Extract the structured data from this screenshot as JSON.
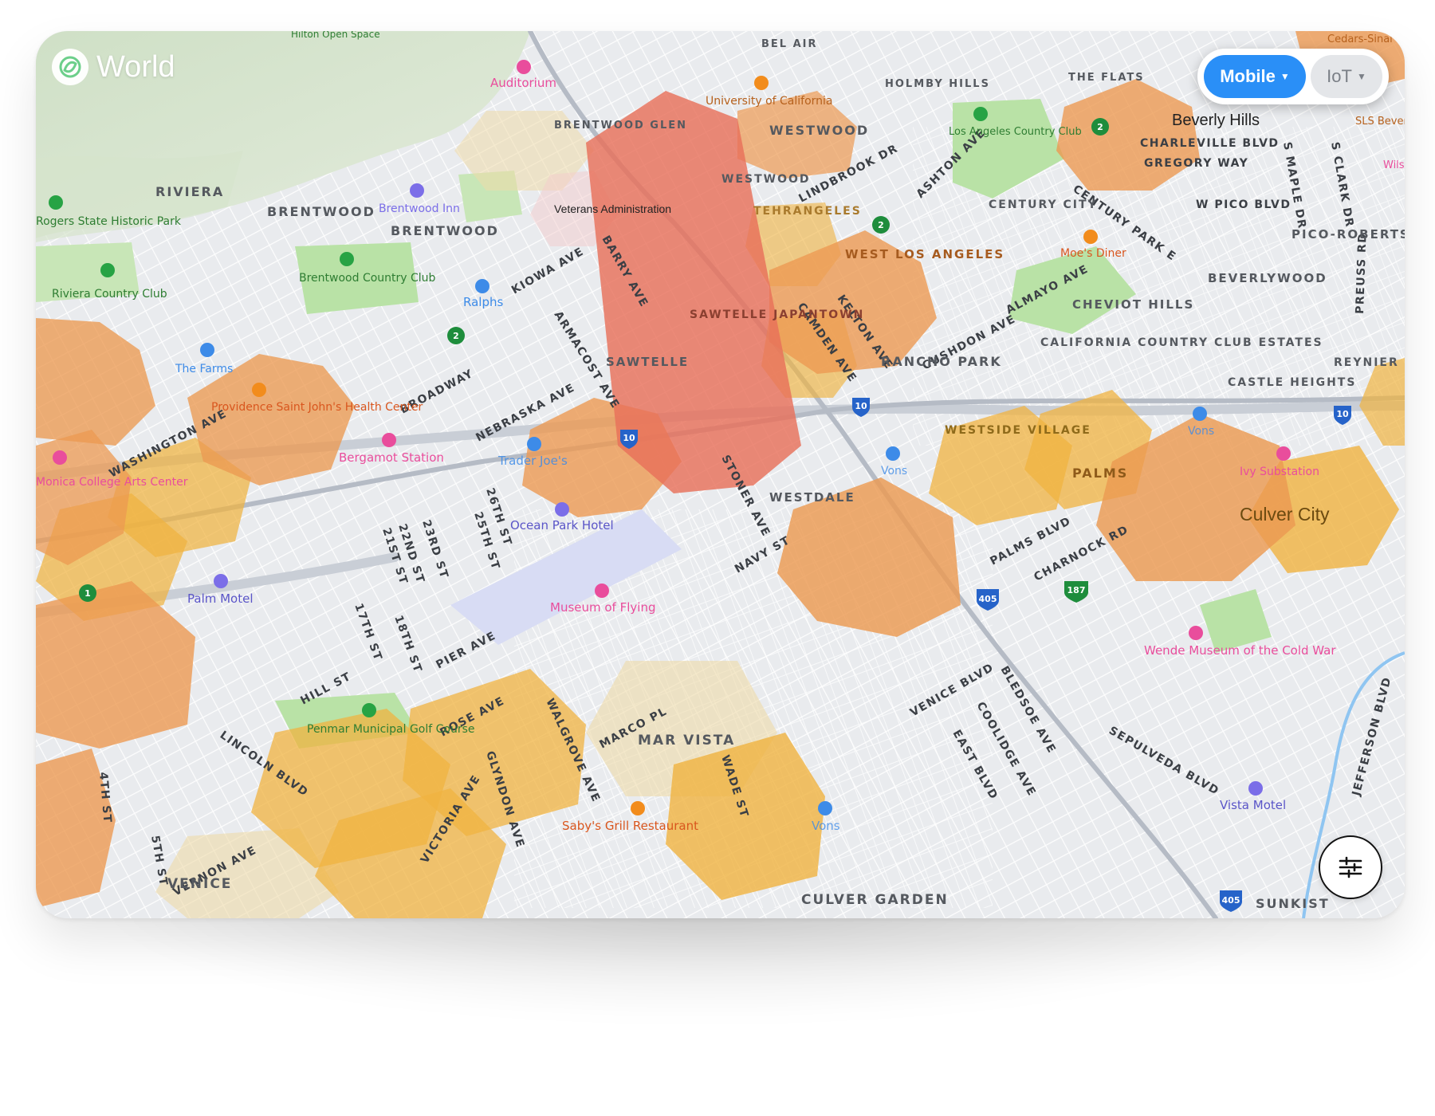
{
  "app": {
    "brand_name": "World"
  },
  "network_toggle": {
    "options": [
      {
        "label": "Mobile",
        "active": true
      },
      {
        "label": "IoT",
        "active": false
      }
    ]
  },
  "icons": {
    "logo": "world-logo-icon",
    "filter": "sliders-filter-icon"
  },
  "colors": {
    "active_toggle": "#2a8ff7",
    "coverage_red": "#e8705a",
    "coverage_orange": "#ec9a52",
    "coverage_amber": "#f0b340",
    "coverage_pale": "#efdba9",
    "poi_pink": "#e94d9c",
    "poi_blue": "#3d8be8",
    "poi_purple": "#7b6ee8",
    "poi_orange": "#f28c1c",
    "poi_green": "#27a344"
  },
  "map": {
    "districts": [
      "RIVIERA",
      "BRENTWOOD",
      "BRENTWOOD",
      "BRENTWOOD GLEN",
      "WESTWOOD",
      "WESTWOOD",
      "HOLMBY HILLS",
      "TEHRANGELES",
      "CENTURY CITY",
      "WEST LOS ANGELES",
      "SAWTELLE JAPANTOWN",
      "SAWTELLE",
      "RANCHO PARK",
      "CHEVIOT HILLS",
      "CALIFORNIA COUNTRY CLUB ESTATES",
      "BEVERLYWOOD",
      "PICO-ROBERTSON",
      "REYNIER VILLAGE",
      "CASTLE HEIGHTS",
      "WESTSIDE VILLAGE",
      "PALMS",
      "WESTDALE",
      "MAR VISTA",
      "VENICE",
      "CULVER GARDEN",
      "SUNKIST",
      "THE FLATS",
      "BEL AIR"
    ],
    "cities": [
      "Beverly Hills",
      "Culver City",
      "Veterans Administration"
    ],
    "streets": [
      "BROADWAY",
      "NEBRASKA AVE",
      "WASHINGTON AVE",
      "KIOWA AVE",
      "ARMACOST AVE",
      "BARRY AVE",
      "STONER AVE",
      "NAVY ST",
      "PIER AVE",
      "HILL ST",
      "ROSE AVE",
      "LINCOLN BLVD",
      "VERNON AVE",
      "PALMS BLVD",
      "VENICE BLVD",
      "SEPULVEDA BLVD",
      "JEFFERSON BLVD",
      "CHARNOCK RD",
      "BLEDSOE AVE",
      "COOLIDGE AVE",
      "EAST BLVD",
      "ALMAYO AVE",
      "CUSHDON AVE",
      "KELTON AVE",
      "CAMDEN AVE",
      "LINDBROOK DR",
      "ASHTON AVE",
      "CENTURY PARK E",
      "W PICO BLVD",
      "CHARLEVILLE BLVD",
      "GREGORY WAY",
      "S MAPLE DR",
      "S CLARK DR",
      "PREUSS RD",
      "WALGROVE AVE",
      "GLYNDON AVE",
      "VICTORIA AVE",
      "MARCO PL",
      "WADE ST",
      "4TH ST",
      "5TH ST",
      "17TH ST",
      "18TH ST",
      "21ST ST",
      "22ND ST",
      "23RD ST",
      "25TH ST",
      "26TH ST",
      "ROSE AVE"
    ],
    "pois": [
      {
        "name": "Auditorium",
        "kind": "pink"
      },
      {
        "name": "University of California",
        "kind": "orange"
      },
      {
        "name": "Brentwood Inn",
        "kind": "purple"
      },
      {
        "name": "Rogers State Historic Park",
        "kind": "green"
      },
      {
        "name": "Riviera Country Club",
        "kind": "green"
      },
      {
        "name": "Brentwood Country Club",
        "kind": "green"
      },
      {
        "name": "Ralphs",
        "kind": "blue"
      },
      {
        "name": "The Farms",
        "kind": "blue"
      },
      {
        "name": "Providence Saint John's Health Center",
        "kind": "orange"
      },
      {
        "name": "Bergamot Station",
        "kind": "pink"
      },
      {
        "name": "Trader Joe's",
        "kind": "blue"
      },
      {
        "name": "Monica College Arts Center",
        "kind": "pink"
      },
      {
        "name": "Ocean Park Hotel",
        "kind": "purple"
      },
      {
        "name": "Palm Motel",
        "kind": "purple"
      },
      {
        "name": "Museum of Flying",
        "kind": "pink"
      },
      {
        "name": "Penmar Municipal Golf Course",
        "kind": "green"
      },
      {
        "name": "Saby's Grill Restaurant",
        "kind": "orange"
      },
      {
        "name": "Vons",
        "kind": "blue"
      },
      {
        "name": "Vons",
        "kind": "blue"
      },
      {
        "name": "Vons",
        "kind": "blue"
      },
      {
        "name": "Moe's Diner",
        "kind": "orange"
      },
      {
        "name": "Los Angeles Country Club",
        "kind": "green"
      },
      {
        "name": "Ivy Substation",
        "kind": "pink"
      },
      {
        "name": "Wende Museum of the Cold War",
        "kind": "pink"
      },
      {
        "name": "Vista Motel",
        "kind": "purple"
      },
      {
        "name": "Hilton Open Space",
        "kind": "green"
      },
      {
        "name": "Cedars-Sinai",
        "kind": "orange"
      },
      {
        "name": "SLS Bever",
        "kind": "orange"
      },
      {
        "name": "Wils",
        "kind": "pink"
      }
    ],
    "highway_shields": [
      "10",
      "10",
      "10",
      "405",
      "405",
      "187",
      "2",
      "2",
      "2",
      "1"
    ]
  }
}
